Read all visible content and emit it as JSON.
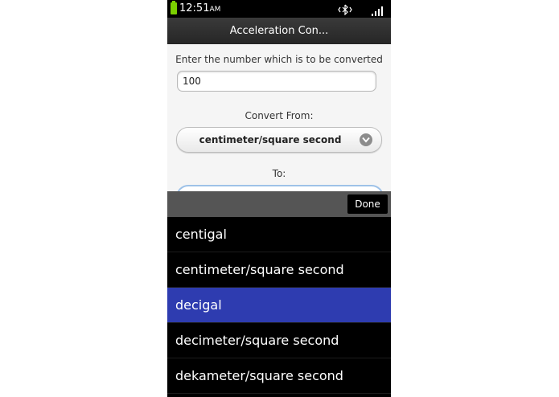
{
  "status_bar": {
    "time": "12:51",
    "ampm": "AM"
  },
  "header": {
    "title": "Acceleration Con..."
  },
  "form": {
    "number_label": "Enter the number which is to be converted",
    "number_value": "100",
    "from_label": "Convert From:",
    "from_value": "centimeter/square second",
    "to_label": "To:"
  },
  "picker": {
    "done_label": "Done",
    "items": [
      {
        "label": "centigal"
      },
      {
        "label": "centimeter/square second"
      },
      {
        "label": "decigal"
      },
      {
        "label": "decimeter/square second"
      },
      {
        "label": "dekameter/square second"
      }
    ],
    "selected": "decigal"
  },
  "colors": {
    "selected_item": "#2e3cb0",
    "battery": "#7bd000",
    "title_bar": "#2f2f2f"
  },
  "icons": [
    "battery-icon",
    "bluetooth-icon",
    "signal-icon",
    "chevron-down-icon"
  ]
}
